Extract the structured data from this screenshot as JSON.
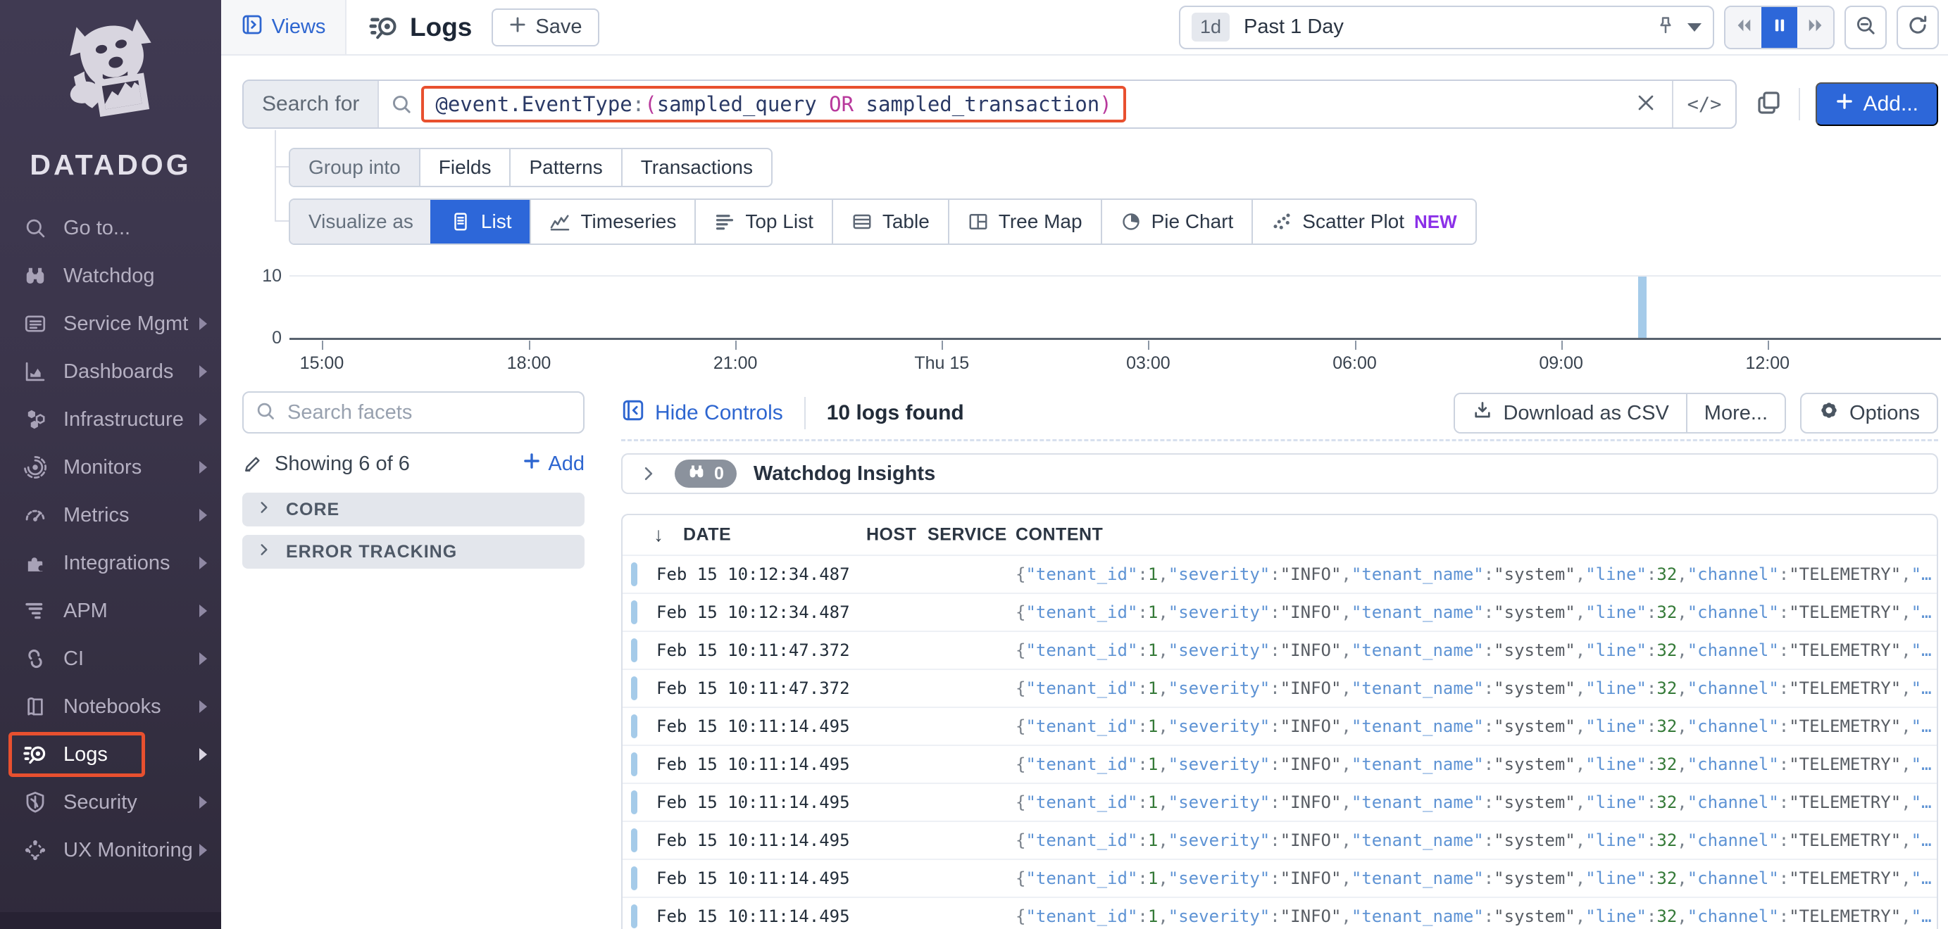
{
  "sidebar": {
    "logo_text": "DATADOG",
    "items": [
      {
        "label": "Go to...",
        "icon": "search-icon",
        "arrow": false,
        "active": false
      },
      {
        "label": "Watchdog",
        "icon": "binoculars-icon",
        "arrow": false,
        "active": false
      },
      {
        "label": "Service Mgmt",
        "icon": "service-list-icon",
        "arrow": true,
        "active": false
      },
      {
        "label": "Dashboards",
        "icon": "dashboard-chart-icon",
        "arrow": true,
        "active": false
      },
      {
        "label": "Infrastructure",
        "icon": "hexagon-cluster-icon",
        "arrow": true,
        "active": false
      },
      {
        "label": "Monitors",
        "icon": "monitor-target-icon",
        "arrow": true,
        "active": false
      },
      {
        "label": "Metrics",
        "icon": "gauge-icon",
        "arrow": true,
        "active": false
      },
      {
        "label": "Integrations",
        "icon": "puzzle-icon",
        "arrow": true,
        "active": false
      },
      {
        "label": "APM",
        "icon": "trace-lines-icon",
        "arrow": true,
        "active": false
      },
      {
        "label": "CI",
        "icon": "ci-link-icon",
        "arrow": true,
        "active": false
      },
      {
        "label": "Notebooks",
        "icon": "notebook-icon",
        "arrow": true,
        "active": false
      },
      {
        "label": "Logs",
        "icon": "logs-magnifier-icon",
        "arrow": true,
        "active": true
      },
      {
        "label": "Security",
        "icon": "shield-icon",
        "arrow": true,
        "active": false
      },
      {
        "label": "UX Monitoring",
        "icon": "globe-network-icon",
        "arrow": true,
        "active": false
      }
    ]
  },
  "header": {
    "views_label": "Views",
    "page_title": "Logs",
    "save_label": "Save",
    "time_range_badge": "1d",
    "time_range_label": "Past 1 Day",
    "time_controls": [
      {
        "icon": "rewind-icon",
        "active": false
      },
      {
        "icon": "pause-icon",
        "active": true
      },
      {
        "icon": "fast-forward-icon",
        "active": false
      }
    ]
  },
  "search": {
    "label": "Search for",
    "query_parts": [
      {
        "text": "@event.EventType",
        "cls": "fld"
      },
      {
        "text": ":",
        "cls": "pun"
      },
      {
        "text": "(",
        "cls": "op"
      },
      {
        "text": "sampled_query",
        "cls": "fld"
      },
      {
        "text": " OR ",
        "cls": "op"
      },
      {
        "text": "sampled_transaction",
        "cls": "fld"
      },
      {
        "text": ")",
        "cls": "op"
      }
    ],
    "add_label": "Add..."
  },
  "group_tabs": {
    "label": "Group into",
    "tabs": [
      {
        "label": "Fields",
        "active": false
      },
      {
        "label": "Patterns",
        "active": false
      },
      {
        "label": "Transactions",
        "active": false
      }
    ]
  },
  "visualize_tabs": {
    "label": "Visualize as",
    "tabs": [
      {
        "label": "List",
        "icon": "list-icon",
        "active": true
      },
      {
        "label": "Timeseries",
        "icon": "timeseries-icon",
        "active": false
      },
      {
        "label": "Top List",
        "icon": "toplist-icon",
        "active": false
      },
      {
        "label": "Table",
        "icon": "table-icon",
        "active": false
      },
      {
        "label": "Tree Map",
        "icon": "treemap-icon",
        "active": false
      },
      {
        "label": "Pie Chart",
        "icon": "pie-chart-icon",
        "active": false
      },
      {
        "label": "Scatter Plot",
        "icon": "scatter-icon",
        "active": false,
        "badge": "NEW"
      }
    ]
  },
  "chart_data": {
    "type": "bar",
    "x_ticks": [
      "15:00",
      "18:00",
      "21:00",
      "Thu 15",
      "03:00",
      "06:00",
      "09:00",
      "12:00"
    ],
    "x_tick_positions_pct": [
      1.96,
      14.5,
      27.0,
      39.5,
      52.0,
      64.5,
      77.0,
      89.5
    ],
    "y_tick_labels": [
      "0",
      "10"
    ],
    "ylim": [
      0,
      10
    ],
    "bars": [
      {
        "x_pct": 81.9,
        "value": 10
      }
    ],
    "bar_color": "#a5cbe9",
    "grid": "horizontal-top-line-only",
    "legend": "none"
  },
  "facets": {
    "search_placeholder": "Search facets",
    "showing_label": "Showing 6 of 6",
    "add_label": "Add",
    "groups": [
      {
        "label": "CORE"
      },
      {
        "label": "ERROR TRACKING"
      }
    ]
  },
  "results": {
    "hide_controls_label": "Hide Controls",
    "count_label": "10 logs found",
    "download_label": "Download as CSV",
    "more_label": "More...",
    "options_label": "Options"
  },
  "insights": {
    "badge_count": "0",
    "label": "Watchdog Insights"
  },
  "logs_table": {
    "columns": [
      "DATE",
      "HOST",
      "SERVICE",
      "CONTENT"
    ],
    "rows": [
      {
        "date": "Feb 15 10:12:34.487"
      },
      {
        "date": "Feb 15 10:12:34.487"
      },
      {
        "date": "Feb 15 10:11:47.372"
      },
      {
        "date": "Feb 15 10:11:47.372"
      },
      {
        "date": "Feb 15 10:11:14.495"
      },
      {
        "date": "Feb 15 10:11:14.495"
      },
      {
        "date": "Feb 15 10:11:14.495"
      },
      {
        "date": "Feb 15 10:11:14.495"
      },
      {
        "date": "Feb 15 10:11:14.495"
      },
      {
        "date": "Feb 15 10:11:14.495"
      }
    ],
    "row_content_tokens": [
      {
        "text": "{",
        "cls": "p"
      },
      {
        "text": "\"tenant_id\"",
        "cls": "k"
      },
      {
        "text": ":",
        "cls": "p"
      },
      {
        "text": "1",
        "cls": "n"
      },
      {
        "text": ",",
        "cls": "p"
      },
      {
        "text": "\"severity\"",
        "cls": "k"
      },
      {
        "text": ":",
        "cls": "p"
      },
      {
        "text": "\"INFO\"",
        "cls": "s"
      },
      {
        "text": ",",
        "cls": "p"
      },
      {
        "text": "\"tenant_name\"",
        "cls": "k"
      },
      {
        "text": ":",
        "cls": "p"
      },
      {
        "text": "\"system\"",
        "cls": "s"
      },
      {
        "text": ",",
        "cls": "p"
      },
      {
        "text": "\"line\"",
        "cls": "k"
      },
      {
        "text": ":",
        "cls": "p"
      },
      {
        "text": "32",
        "cls": "n"
      },
      {
        "text": ",",
        "cls": "p"
      },
      {
        "text": "\"channel\"",
        "cls": "k"
      },
      {
        "text": ":",
        "cls": "p"
      },
      {
        "text": "\"TELEMETRY\"",
        "cls": "s"
      },
      {
        "text": ",",
        "cls": "p"
      },
      {
        "text": "\"…",
        "cls": "k"
      }
    ]
  },
  "colors": {
    "accent_blue": "#2d67d9",
    "highlight_red": "#e8502f",
    "bar_blue": "#a5cbe9",
    "new_badge_purple": "#8b30e8",
    "sidebar_bg": "#3b354b"
  }
}
